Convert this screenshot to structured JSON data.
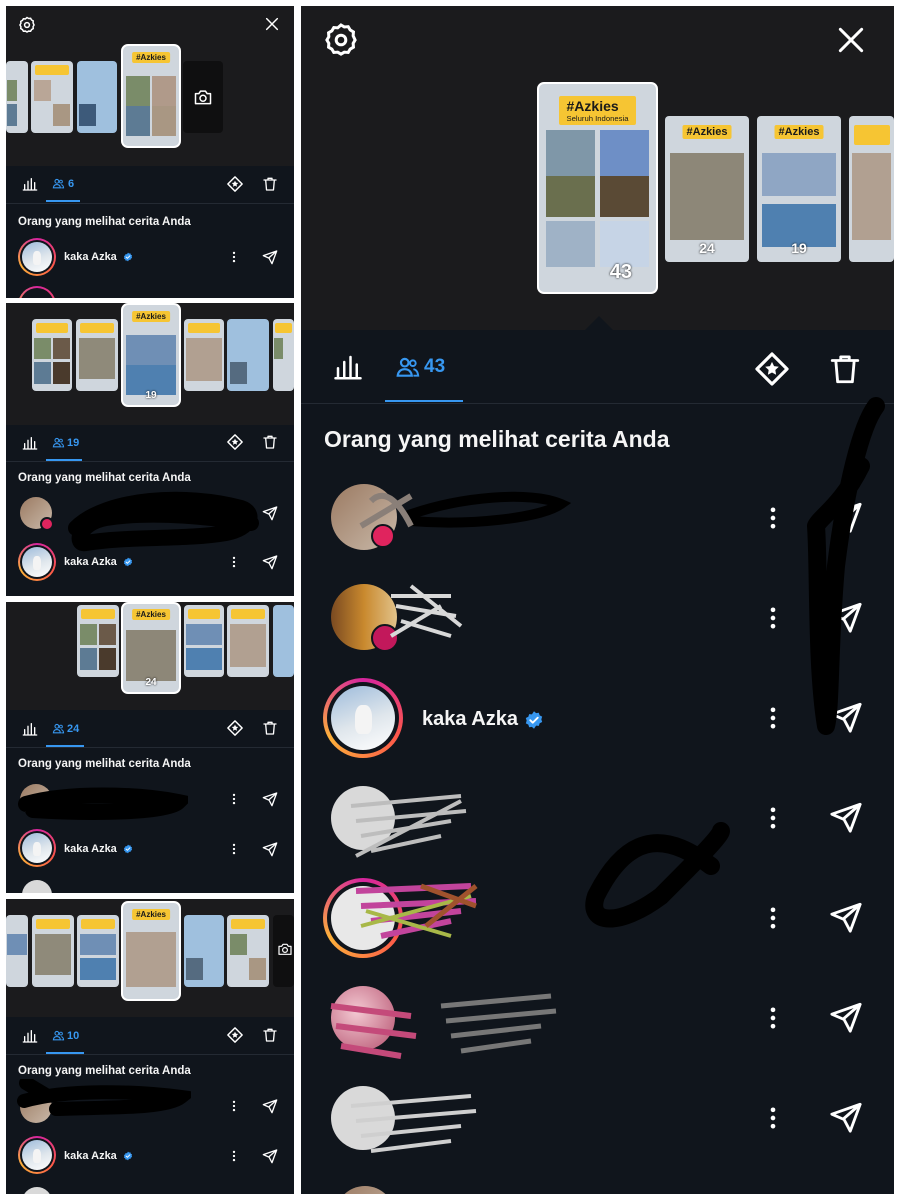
{
  "colors": {
    "accent": "#3797f0",
    "panel_bg": "#10151c",
    "header_bg": "#1b1b1d",
    "text": "#f5f5f5",
    "verified": "#3797f0"
  },
  "story_card": {
    "hashtag": "#Azkies",
    "subtitle": "Seluruh Indonesia"
  },
  "panels": [
    {
      "viewer_count": "6",
      "heading": "Orang yang melihat cerita Anda",
      "viewer_name": "kaka Azka"
    },
    {
      "viewer_count": "19",
      "heading": "Orang yang melihat cerita Anda",
      "viewer_name": "kaka Azka",
      "thumb_count": "19"
    },
    {
      "viewer_count": "24",
      "heading": "Orang yang melihat cerita Anda",
      "viewer_name": "kaka Azka",
      "thumb_count": "24"
    },
    {
      "viewer_count": "10",
      "heading": "Orang yang melihat cerita Anda",
      "viewer_name": "kaka Azka"
    }
  ],
  "main": {
    "viewer_count": "43",
    "heading": "Orang yang melihat cerita Anda",
    "thumb_counts": [
      "43",
      "24",
      "19"
    ],
    "viewers": [
      {
        "name": "",
        "avatar": "brown",
        "redacted": true
      },
      {
        "name": "",
        "avatar": "library",
        "redacted": true
      },
      {
        "name": "kaka Azka",
        "avatar": "story-ring",
        "verified": true
      },
      {
        "name": "",
        "avatar": "gray",
        "redacted": true
      },
      {
        "name": "",
        "avatar": "story-ring",
        "redacted": true
      },
      {
        "name": "",
        "avatar": "pink",
        "redacted": true
      },
      {
        "name": "",
        "avatar": "gray",
        "redacted": true
      }
    ]
  },
  "icons": [
    "settings-icon",
    "close-icon",
    "camera-icon",
    "insights-icon",
    "viewers-icon",
    "highlight-icon",
    "delete-icon",
    "more-icon",
    "send-icon",
    "verified-icon"
  ]
}
